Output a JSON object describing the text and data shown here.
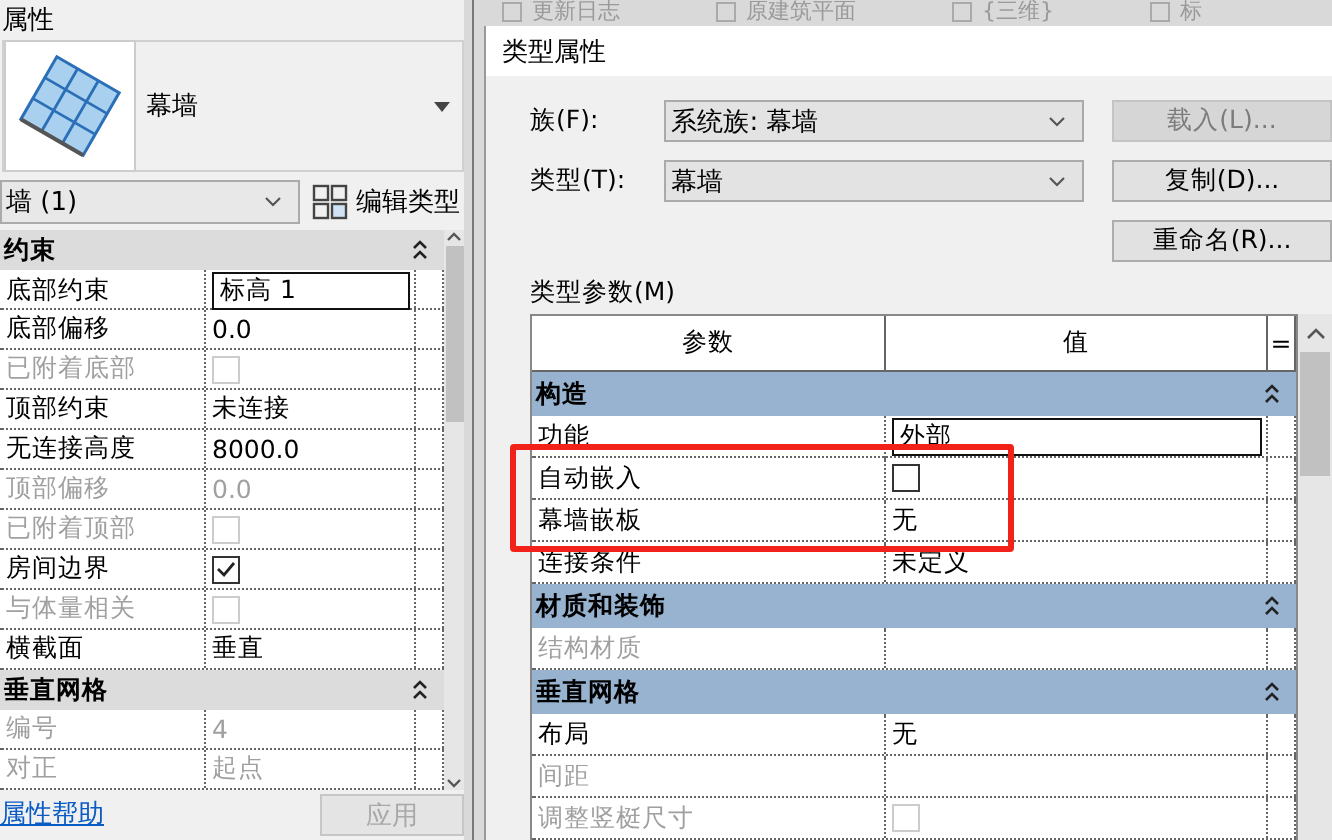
{
  "background_tabs": [
    {
      "label": "更新日志"
    },
    {
      "label": "原建筑平面"
    },
    {
      "label": "{三维}"
    },
    {
      "label": "标"
    }
  ],
  "properties_panel": {
    "title": "属性",
    "type_name": "幕墙",
    "instance_selector": "墙 (1)",
    "edit_type_button": "编辑类型",
    "groups": [
      {
        "name": "约束",
        "rows": [
          {
            "name": "底部约束",
            "kind": "text",
            "value": "标高 1",
            "editing": true,
            "disabled": false
          },
          {
            "name": "底部偏移",
            "kind": "text",
            "value": "0.0",
            "editing": false,
            "disabled": false
          },
          {
            "name": "已附着底部",
            "kind": "checkbox",
            "checked": false,
            "editing": false,
            "disabled": true
          },
          {
            "name": "顶部约束",
            "kind": "text",
            "value": "未连接",
            "editing": false,
            "disabled": false
          },
          {
            "name": "无连接高度",
            "kind": "text",
            "value": "8000.0",
            "editing": false,
            "disabled": false
          },
          {
            "name": "顶部偏移",
            "kind": "text",
            "value": "0.0",
            "editing": false,
            "disabled": true
          },
          {
            "name": "已附着顶部",
            "kind": "checkbox",
            "checked": false,
            "editing": false,
            "disabled": true
          },
          {
            "name": "房间边界",
            "kind": "checkbox",
            "checked": true,
            "editing": false,
            "disabled": false
          },
          {
            "name": "与体量相关",
            "kind": "checkbox",
            "checked": false,
            "editing": false,
            "disabled": true
          },
          {
            "name": "横截面",
            "kind": "text",
            "value": "垂直",
            "editing": false,
            "disabled": false
          }
        ]
      },
      {
        "name": "垂直网格",
        "rows": [
          {
            "name": "编号",
            "kind": "text",
            "value": "4",
            "editing": false,
            "disabled": true
          },
          {
            "name": "对正",
            "kind": "text",
            "value": "起点",
            "editing": false,
            "disabled": true
          }
        ]
      }
    ],
    "help_link": "属性帮助",
    "apply_button": {
      "label": "应用",
      "disabled": true
    }
  },
  "type_dialog": {
    "title": "类型属性",
    "family_label": "族(F):",
    "family_value": "系统族: 幕墙",
    "type_label": "类型(T):",
    "type_value": "幕墙",
    "buttons": [
      {
        "label": "载入(L)...",
        "disabled": true
      },
      {
        "label": "复制(D)...",
        "disabled": false
      },
      {
        "label": "重命名(R)...",
        "disabled": false
      }
    ],
    "params_label": "类型参数(M)",
    "columns": [
      "参数",
      "值",
      "="
    ],
    "groups": [
      {
        "name": "构造",
        "rows": [
          {
            "name": "功能",
            "kind": "text",
            "value": "外部",
            "editing": true,
            "disabled": false,
            "highlighted": false
          },
          {
            "name": "自动嵌入",
            "kind": "checkbox",
            "checked": false,
            "editing": false,
            "disabled": false,
            "highlighted": true
          },
          {
            "name": "幕墙嵌板",
            "kind": "text",
            "value": "无",
            "editing": false,
            "disabled": false,
            "highlighted": true
          },
          {
            "name": "连接条件",
            "kind": "text",
            "value": "未定义",
            "editing": false,
            "disabled": false,
            "highlighted": false
          }
        ]
      },
      {
        "name": "材质和装饰",
        "rows": [
          {
            "name": "结构材质",
            "kind": "text",
            "editing": false,
            "disabled": true,
            "highlighted": false
          }
        ]
      },
      {
        "name": "垂直网格",
        "rows": [
          {
            "name": "布局",
            "kind": "text",
            "value": "无",
            "editing": false,
            "disabled": false,
            "highlighted": false
          },
          {
            "name": "间距",
            "kind": "text",
            "editing": false,
            "disabled": true,
            "highlighted": false
          },
          {
            "name": "调整竖梃尺寸",
            "kind": "checkbox",
            "checked": false,
            "editing": false,
            "disabled": true,
            "highlighted": false
          }
        ]
      }
    ]
  }
}
